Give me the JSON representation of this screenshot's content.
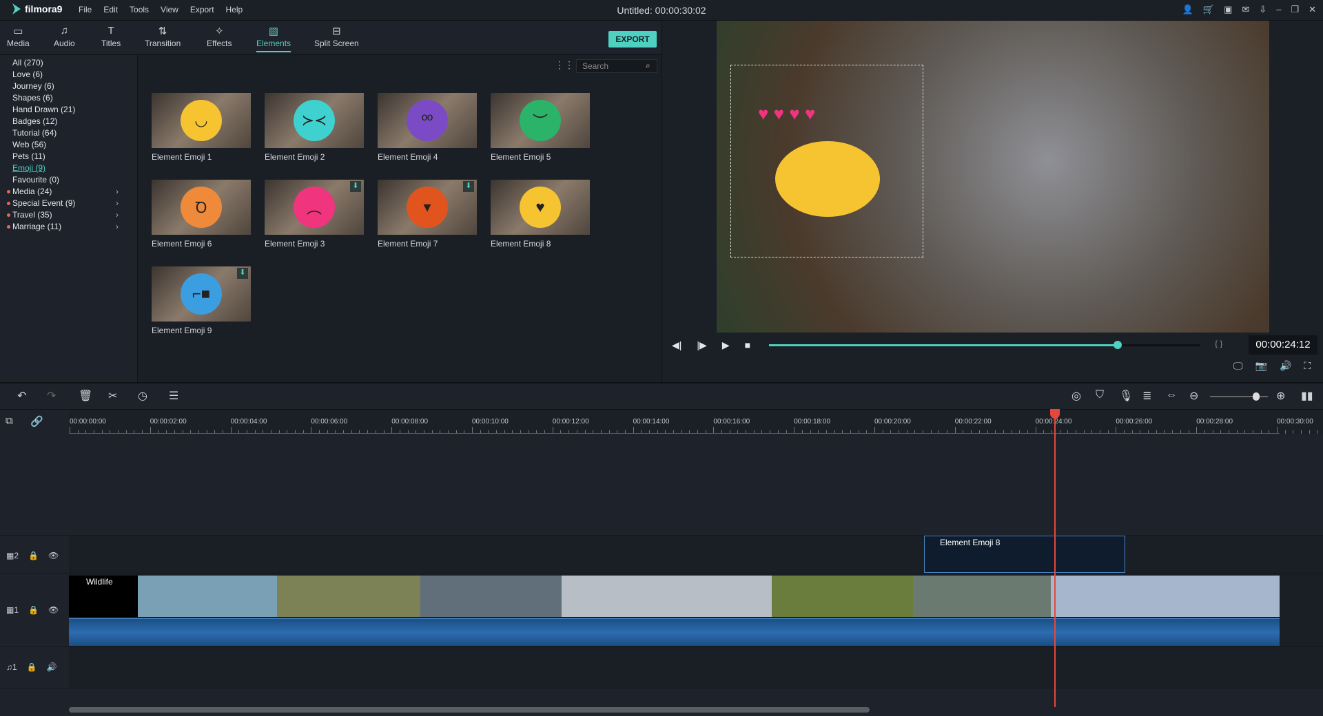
{
  "app": {
    "name": "filmora9",
    "title": "Untitled: 00:00:30:02",
    "menu": [
      "File",
      "Edit",
      "Tools",
      "View",
      "Export",
      "Help"
    ]
  },
  "tabs": [
    {
      "label": "Media",
      "icon": "folder-icon"
    },
    {
      "label": "Audio",
      "icon": "music-note-icon"
    },
    {
      "label": "Titles",
      "icon": "text-icon"
    },
    {
      "label": "Transition",
      "icon": "transition-icon"
    },
    {
      "label": "Effects",
      "icon": "effects-icon"
    },
    {
      "label": "Elements",
      "icon": "image-icon",
      "active": true
    },
    {
      "label": "Split Screen",
      "icon": "split-screen-icon"
    }
  ],
  "export_label": "EXPORT",
  "categories": [
    "All (270)",
    "Love (6)",
    "Journey (6)",
    "Shapes (6)",
    "Hand Drawn (21)",
    "Badges (12)",
    "Tutorial (64)",
    "Web (56)",
    "Pets (11)",
    "Emoji (9)",
    "Favourite (0)",
    "Media (24)",
    "Special Event (9)",
    "Travel (35)",
    "Marriage (11)"
  ],
  "active_category": "Emoji (9)",
  "search": {
    "placeholder": "Search"
  },
  "elements": [
    {
      "label": "Element Emoji 1",
      "color": "#f6c431",
      "download": false
    },
    {
      "label": "Element Emoji 2",
      "color": "#3fd1d0",
      "download": false
    },
    {
      "label": "Element Emoji 4",
      "color": "#7a4bc4",
      "download": false
    },
    {
      "label": "Element Emoji 5",
      "color": "#2bb36a",
      "download": false
    },
    {
      "label": "Element Emoji 6",
      "color": "#ef8a3a",
      "download": false
    },
    {
      "label": "Element Emoji 3",
      "color": "#f0347e",
      "download": true
    },
    {
      "label": "Element Emoji 7",
      "color": "#e2541e",
      "download": true
    },
    {
      "label": "Element Emoji 8",
      "color": "#f6c431",
      "download": false
    },
    {
      "label": "Element Emoji 9",
      "color": "#3a9ee0",
      "download": true
    }
  ],
  "player": {
    "timecode": "00:00:24:12",
    "progress": 0.81
  },
  "timeline": {
    "ruler": [
      "00:00:00:00",
      "00:00:02:00",
      "00:00:04:00",
      "00:00:06:00",
      "00:00:08:00",
      "00:00:10:00",
      "00:00:12:00",
      "00:00:14:00",
      "00:00:16:00",
      "00:00:18:00",
      "00:00:20:00",
      "00:00:22:00",
      "00:00:24:00",
      "00:00:26:00",
      "00:00:28:00",
      "00:00:30:00"
    ],
    "zoom_level": 0.8,
    "tracks": {
      "video2": "2",
      "video1": "1",
      "audio1": "1"
    },
    "clips": {
      "element": "Element Emoji 8",
      "video": "Wildlife"
    }
  }
}
